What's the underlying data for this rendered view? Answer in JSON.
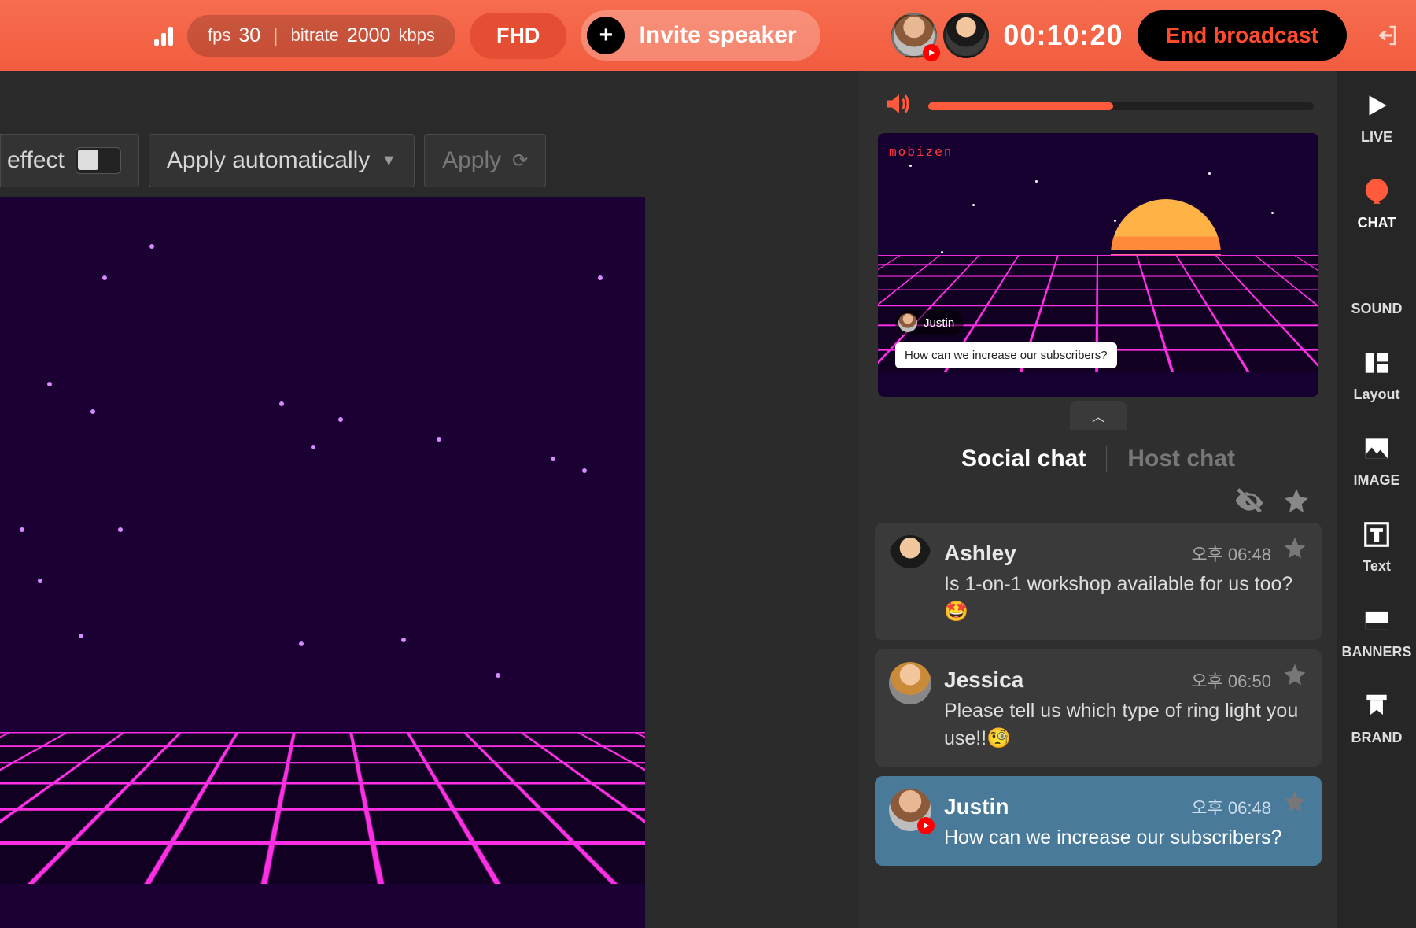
{
  "topbar": {
    "fps_label": "fps",
    "fps_value": "30",
    "bitrate_label": "bitrate",
    "bitrate_value": "2000",
    "bitrate_unit": "kbps",
    "quality_badge": "FHD",
    "invite_label": "Invite speaker",
    "timer": "00:10:20",
    "end_label": "End broadcast"
  },
  "stage_toolbar": {
    "effect_label": "effect",
    "auto_label": "Apply automatically",
    "apply_label": "Apply"
  },
  "panel": {
    "volume_percent": 48,
    "preview_brand": "mobizen",
    "preview_user": "Justin",
    "preview_bubble": "How can we increase our subscribers?",
    "tabs": {
      "social": "Social chat",
      "host": "Host chat"
    },
    "messages": [
      {
        "name": "Ashley",
        "time": "오후 06:48",
        "text": "Is 1-on-1 workshop available for us too? 🤩",
        "selected": false,
        "platform": false,
        "avatar": "style-b"
      },
      {
        "name": "Jessica",
        "time": "오후 06:50",
        "text": "Please tell us which type of ring light you use!!🧐",
        "selected": false,
        "platform": false,
        "avatar": "style-c"
      },
      {
        "name": "Justin",
        "time": "오후 06:48",
        "text": "How can we increase our subscribers?",
        "selected": true,
        "platform": true,
        "avatar": "style-a"
      }
    ]
  },
  "rail": {
    "live": "LIVE",
    "chat": "CHAT",
    "sound": "SOUND",
    "layout": "Layout",
    "image": "IMAGE",
    "text": "Text",
    "banners": "BANNERS",
    "brand": "BRAND"
  }
}
